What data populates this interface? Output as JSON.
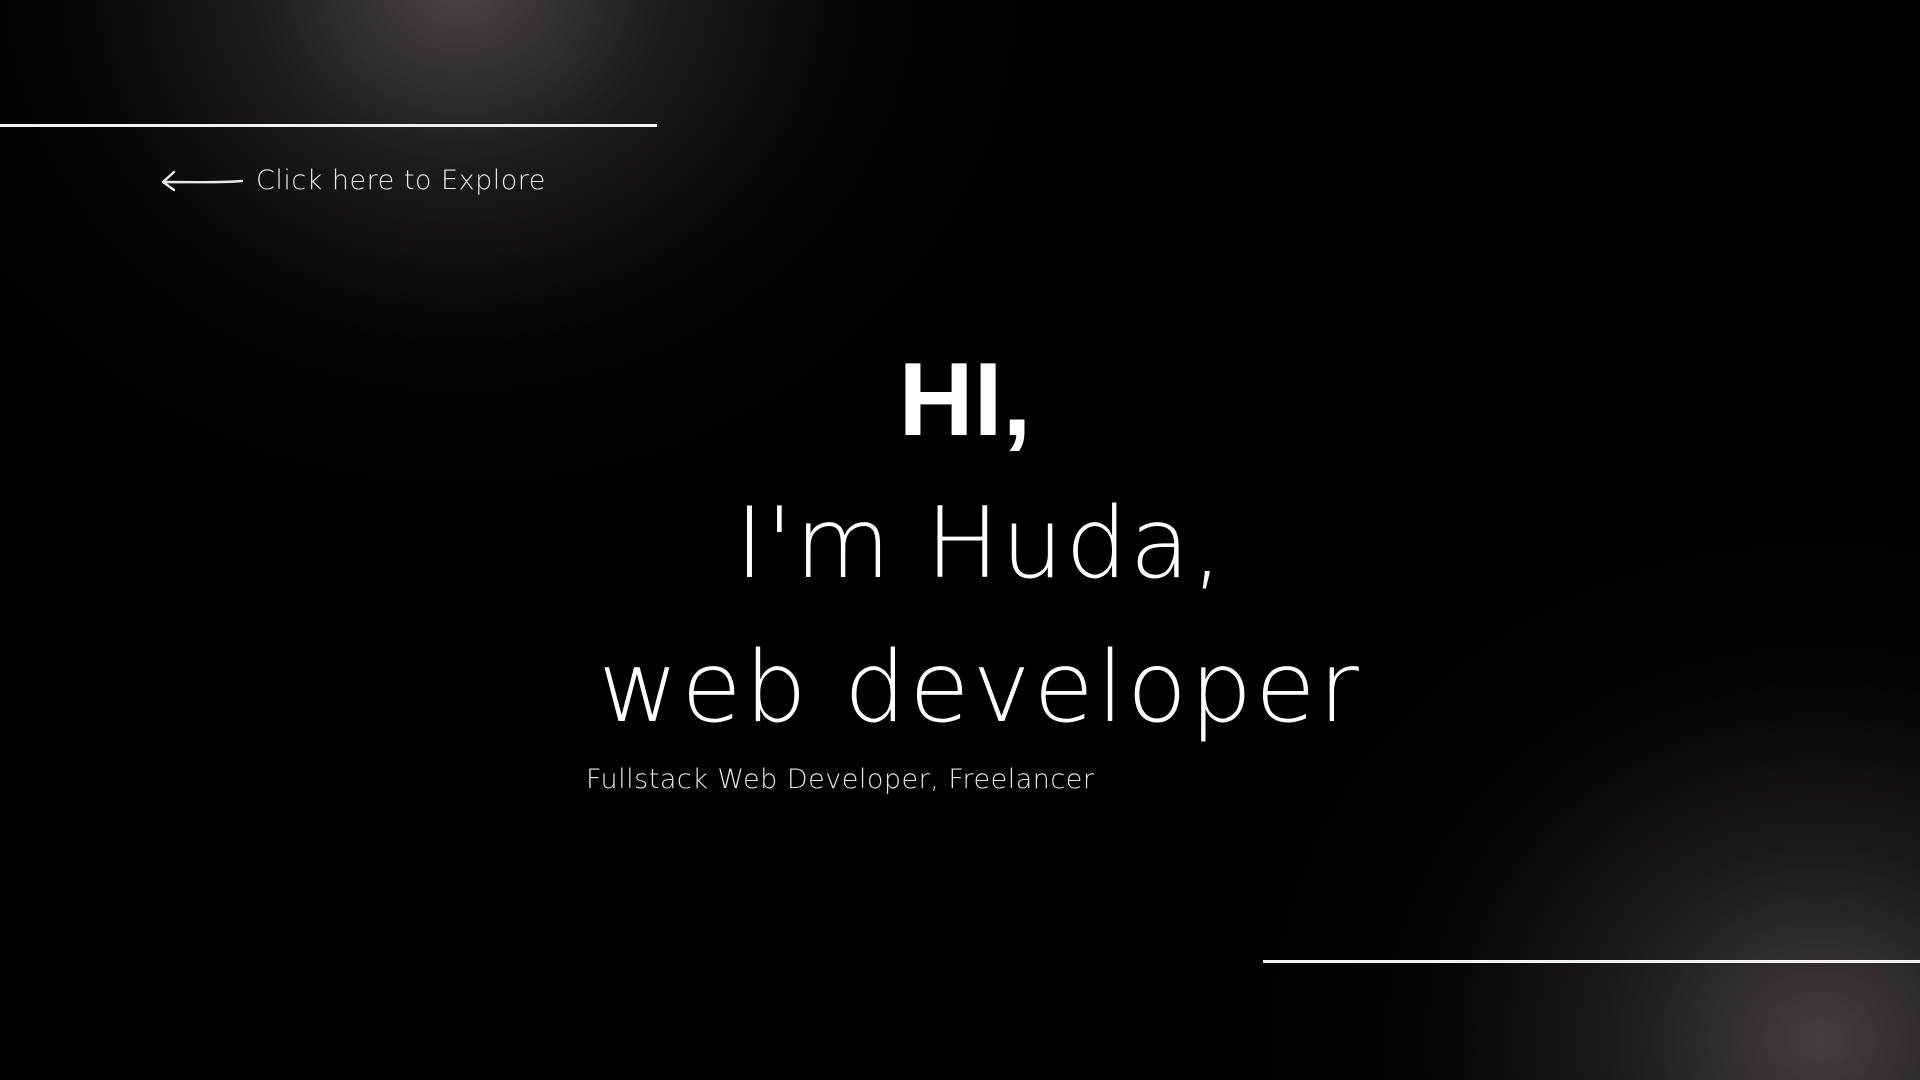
{
  "explore": {
    "label": "Click here to Explore",
    "icon": "arrow-left-icon"
  },
  "hero": {
    "greeting": "HI,",
    "name_line": "I'm Huda,",
    "role_line": "web developer",
    "subtitle": "Fullstack Web Developer, Freelancer"
  },
  "colors": {
    "background": "#000000",
    "text": "#ffffff",
    "glow": "#524c4c"
  }
}
